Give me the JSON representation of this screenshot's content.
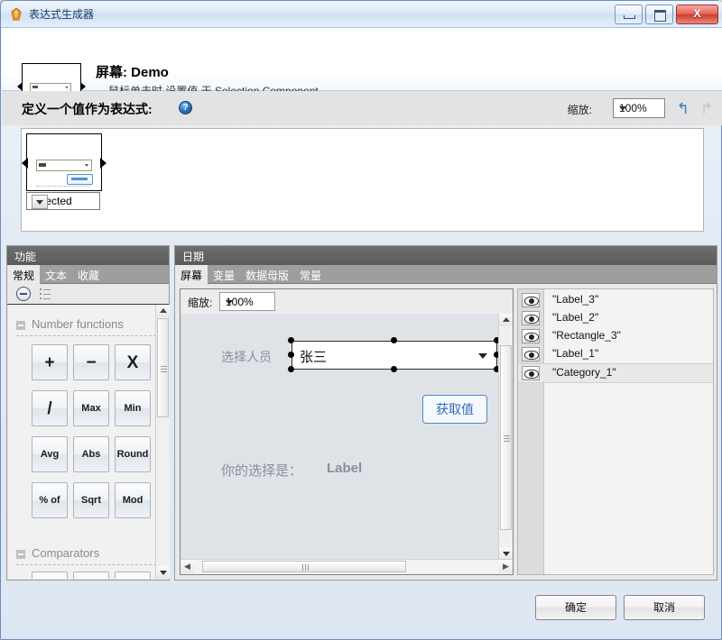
{
  "window": {
    "title": "表达式生成器",
    "icon": "app-diamond-icon",
    "minimize_label": "",
    "maximize_label": "",
    "close_label": "X"
  },
  "header": {
    "title": "屏幕: Demo",
    "subtitle": "鼠标单击时 设置值 于 Selection Component"
  },
  "define": {
    "label": "定义一个值作为表达式:",
    "help": "?",
    "zoom_label": "缩放:",
    "zoom_value": "100%",
    "undo": "↰",
    "redo": "↱"
  },
  "expression": {
    "property_value": "selected"
  },
  "functions_panel": {
    "header": "功能",
    "tabs": [
      {
        "label": "常规",
        "active": true
      },
      {
        "label": "文本",
        "active": false
      },
      {
        "label": "收藏",
        "active": false
      }
    ],
    "toolbar": {
      "collapse_icon": "circle-minus-icon",
      "list_icon": "list-icon"
    },
    "groups": [
      {
        "title": "Number functions",
        "buttons": [
          "+",
          "−",
          "X",
          "/",
          "Max",
          "Min",
          "Avg",
          "Abs",
          "Round",
          "% of",
          "Sqrt",
          "Mod"
        ]
      },
      {
        "title": "Comparators",
        "buttons": [
          "=",
          "≠",
          ">"
        ]
      }
    ]
  },
  "date_panel": {
    "header": "日期",
    "tabs": [
      {
        "label": "屏幕",
        "active": true
      },
      {
        "label": "变量",
        "active": false
      },
      {
        "label": "数据母版",
        "active": false
      },
      {
        "label": "常量",
        "active": false
      }
    ],
    "canvas": {
      "zoom_label": "缩放:",
      "zoom_value": "100%",
      "stage": {
        "select_label": "选择人员",
        "dropdown_value": "张三",
        "button_label": "获取值",
        "result_label": "你的选择是：",
        "result_value": "Label"
      }
    },
    "objects": [
      {
        "name": "\"Label_3\"",
        "selected": false,
        "visibility_icon": "eye-icon"
      },
      {
        "name": "\"Label_2\"",
        "selected": false,
        "visibility_icon": "eye-icon"
      },
      {
        "name": "\"Rectangle_3\"",
        "selected": false,
        "visibility_icon": "eye-icon"
      },
      {
        "name": "\"Label_1\"",
        "selected": false,
        "visibility_icon": "eye-icon"
      },
      {
        "name": "\"Category_1\"",
        "selected": true,
        "visibility_icon": "eye-icon"
      }
    ]
  },
  "footer": {
    "ok_label": "确定",
    "cancel_label": "取消"
  },
  "colors": {
    "accent_blue": "#2f6ab3",
    "panel_header": "#5b5b5b",
    "close_red": "#cf3d2c",
    "stage_bg": "#dfe3e8"
  }
}
